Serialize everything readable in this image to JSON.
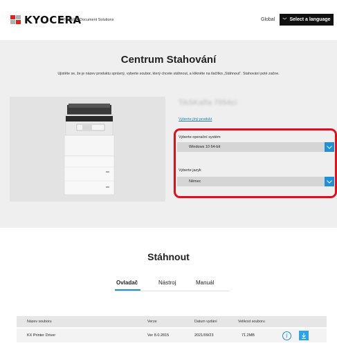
{
  "header": {
    "logo_text": "KYOCERA",
    "company_name": "KYOCERA Document Solutions",
    "region_label": "Global",
    "language_button": "Select a language"
  },
  "hero": {
    "title": "Centrum Stahování",
    "subtitle": "Ujistěte se, že je název produktu správný, vyberte soubor, který chcete stáhnout, a klikněte na tlačítko „Stáhnout“. Stahování poté začne."
  },
  "product": {
    "name": "TASKalfa 7054ci",
    "change_link": "Vyberte jiný produkt",
    "image_name": "multifunction-printer"
  },
  "os_select": {
    "label": "Vyberte operační systém",
    "value": "Windows 10 64-bit"
  },
  "language_select": {
    "label": "Vyberte jazyk",
    "value": "Němec"
  },
  "download": {
    "title": "Stáhnout",
    "tabs": [
      "Ovladač",
      "Nástroj",
      "Manuál"
    ],
    "active_tab": "Ovladač",
    "columns": [
      "Název souboru",
      "Verze",
      "Datum vydání",
      "Velikost souboru"
    ],
    "rows": [
      {
        "name": "KX Printer Driver",
        "version": "Ver 8.0.2815",
        "date": "2021/09/23",
        "size": "71.2MB"
      }
    ]
  },
  "colors": {
    "accent": "#1f8fd6",
    "highlight": "#e0101a",
    "brand": "#e2231a"
  }
}
